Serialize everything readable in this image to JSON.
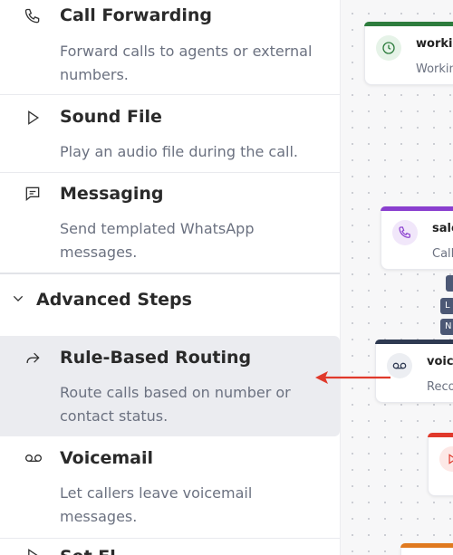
{
  "steps": {
    "call_forwarding": {
      "title": "Call Forwarding",
      "desc": "Forward calls to agents or external numbers.",
      "icon": "phone-icon"
    },
    "sound_file": {
      "title": "Sound File",
      "desc": "Play an audio file during the call.",
      "icon": "play-icon"
    },
    "messaging": {
      "title": "Messaging",
      "desc": "Send templated WhatsApp messages.",
      "icon": "message-icon"
    }
  },
  "advanced": {
    "header": "Advanced Steps",
    "rule_routing": {
      "title": "Rule-Based Routing",
      "desc": "Route calls based on number or contact status.",
      "icon": "share-arrow-icon"
    },
    "voicemail": {
      "title": "Voicemail",
      "desc": "Let callers leave voicemail messages.",
      "icon": "voicemail-icon"
    },
    "next_partial": {
      "title": "Set Fl"
    }
  },
  "canvas": {
    "nodes": [
      {
        "label": "workin",
        "sub": "Workin",
        "color": "#2e7d3e"
      },
      {
        "label": "sale",
        "sub": "Call",
        "color": "#8a3fcf"
      },
      {
        "label": "voice",
        "sub": "Recor",
        "color": "#2f3a52"
      }
    ],
    "tags": [
      "L",
      "N"
    ]
  },
  "colors": {
    "arrow": "#e0392b"
  }
}
